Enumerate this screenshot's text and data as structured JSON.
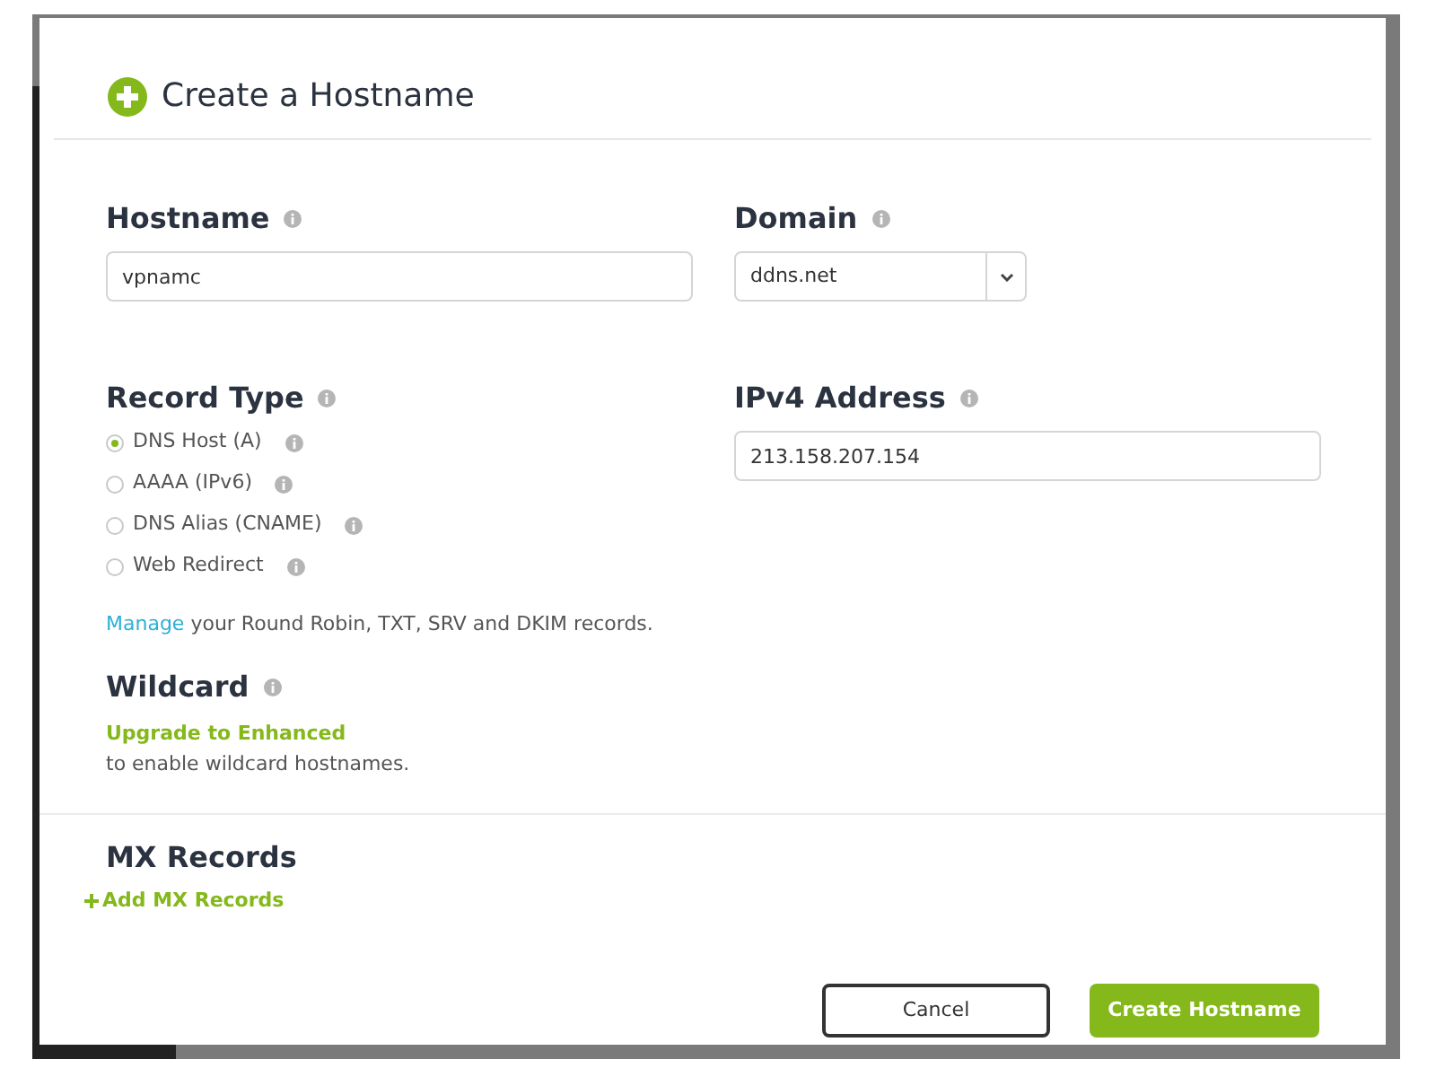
{
  "dialog": {
    "title": "Create a Hostname"
  },
  "hostname": {
    "label": "Hostname",
    "value": "vpnamc"
  },
  "domain": {
    "label": "Domain",
    "value": "ddns.net"
  },
  "record_type": {
    "label": "Record Type",
    "options": [
      {
        "label": "DNS Host (A)",
        "selected": true
      },
      {
        "label": "AAAA (IPv6)",
        "selected": false
      },
      {
        "label": "DNS Alias (CNAME)",
        "selected": false
      },
      {
        "label": "Web Redirect",
        "selected": false
      }
    ]
  },
  "ipv4": {
    "label": "IPv4 Address",
    "value": "213.158.207.154"
  },
  "manage_note": {
    "link": "Manage",
    "text": "your Round Robin, TXT, SRV and DKIM records."
  },
  "wildcard": {
    "label": "Wildcard",
    "link": "Upgrade to Enhanced",
    "note": "to enable wildcard hostnames."
  },
  "mx_records": {
    "label": "MX Records",
    "add_link": "Add MX Records"
  },
  "buttons": {
    "cancel": "Cancel",
    "submit": "Create Hostname"
  }
}
